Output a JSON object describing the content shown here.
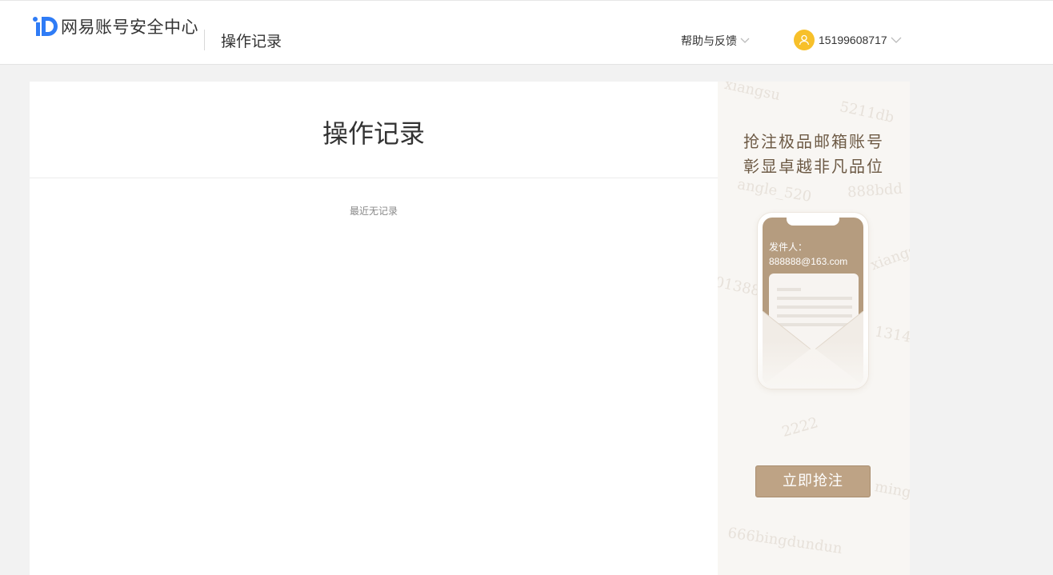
{
  "header": {
    "brand": "网易账号安全中心",
    "page": "操作记录",
    "help_label": "帮助与反馈",
    "user_phone": "15199608717"
  },
  "main": {
    "title": "操作记录",
    "empty_message": "最近无记录"
  },
  "ad": {
    "headline_line1": "抢注极品邮箱账号",
    "headline_line2": "彰显卓越非凡品位",
    "sender_label": "发件人：",
    "sender_email": "888888@163.com",
    "cta_label": "立即抢注",
    "watermarks": [
      "5211db",
      "angle_520",
      "888bdd",
      "xiangs",
      "01388",
      "2222",
      "666bingdundun",
      "ming",
      "1314"
    ]
  },
  "colors": {
    "brand_blue": "#2f7cf6",
    "avatar_yellow": "#f7c02a",
    "cta_gold": "#bea385",
    "ad_text": "#6d5a45"
  },
  "icons": {
    "logo": "id-logo-icon",
    "help_dropdown": "chevron-down-icon",
    "user_dropdown": "chevron-down-icon",
    "avatar": "user-icon"
  }
}
